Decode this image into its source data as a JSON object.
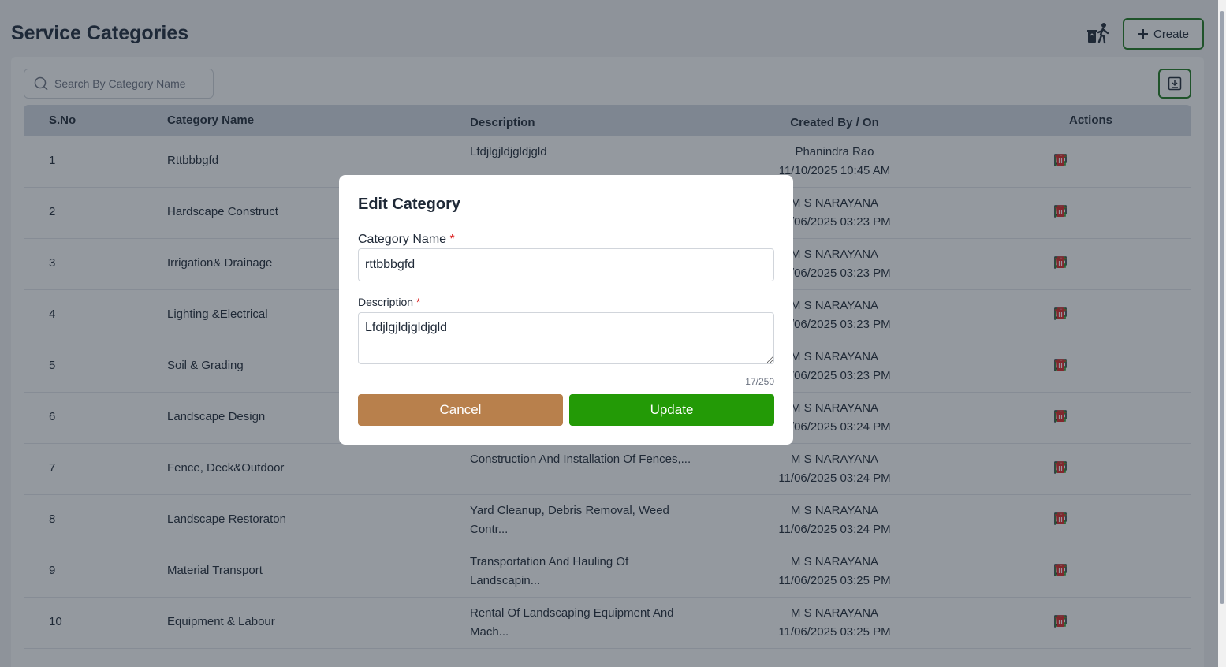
{
  "page": {
    "title": "Service Categories"
  },
  "toolbar": {
    "create_label": "Create"
  },
  "search": {
    "placeholder": "Search By Category Name"
  },
  "table": {
    "headers": {
      "sno": "S.No",
      "name": "Category Name",
      "desc": "Description",
      "created": "Created By / On",
      "actions": "Actions"
    },
    "rows": [
      {
        "sno": "1",
        "name": "Rttbbbgfd",
        "desc": "Lfdjlgjldjgldjgld",
        "by": "Phanindra Rao",
        "on": "11/10/2025 10:45 AM"
      },
      {
        "sno": "2",
        "name": "Hardscape Construct",
        "desc": "",
        "by": "M S NARAYANA",
        "on": "11/06/2025 03:23 PM"
      },
      {
        "sno": "3",
        "name": "Irrigation& Drainage",
        "desc": "",
        "by": "M S NARAYANA",
        "on": "11/06/2025 03:23 PM"
      },
      {
        "sno": "4",
        "name": "Lighting &Electrical",
        "desc": "",
        "by": "M S NARAYANA",
        "on": "11/06/2025 03:23 PM"
      },
      {
        "sno": "5",
        "name": "Soil & Grading",
        "desc": "",
        "by": "M S NARAYANA",
        "on": "11/06/2025 03:23 PM"
      },
      {
        "sno": "6",
        "name": "Landscape Design",
        "desc": "",
        "by": "M S NARAYANA",
        "on": "11/06/2025 03:24 PM"
      },
      {
        "sno": "7",
        "name": "Fence, Deck&Outdoor",
        "desc": "Construction And Installation Of Fences,...",
        "by": "M S NARAYANA",
        "on": "11/06/2025 03:24 PM"
      },
      {
        "sno": "8",
        "name": "Landscape Restoraton",
        "desc": "Yard Cleanup, Debris Removal, Weed Contr...",
        "by": "M S NARAYANA",
        "on": "11/06/2025 03:24 PM"
      },
      {
        "sno": "9",
        "name": "Material Transport",
        "desc": "Transportation And Hauling Of Landscapin...",
        "by": "M S NARAYANA",
        "on": "11/06/2025 03:25 PM"
      },
      {
        "sno": "10",
        "name": "Equipment & Labour",
        "desc": "Rental Of Landscaping Equipment And Mach...",
        "by": "M S NARAYANA",
        "on": "11/06/2025 03:25 PM"
      }
    ]
  },
  "modal": {
    "title": "Edit Category",
    "name_label": "Category Name",
    "name_value": "rttbbbgfd",
    "desc_label": "Description",
    "desc_value": "Lfdjlgjldjgldjgld",
    "required_mark": "*",
    "counter": "17/250",
    "cancel_label": "Cancel",
    "update_label": "Update"
  },
  "colors": {
    "accent": "#239a06",
    "cancel": "#b8804c",
    "border_green": "#1f7a1f",
    "delete": "#dc2626"
  }
}
